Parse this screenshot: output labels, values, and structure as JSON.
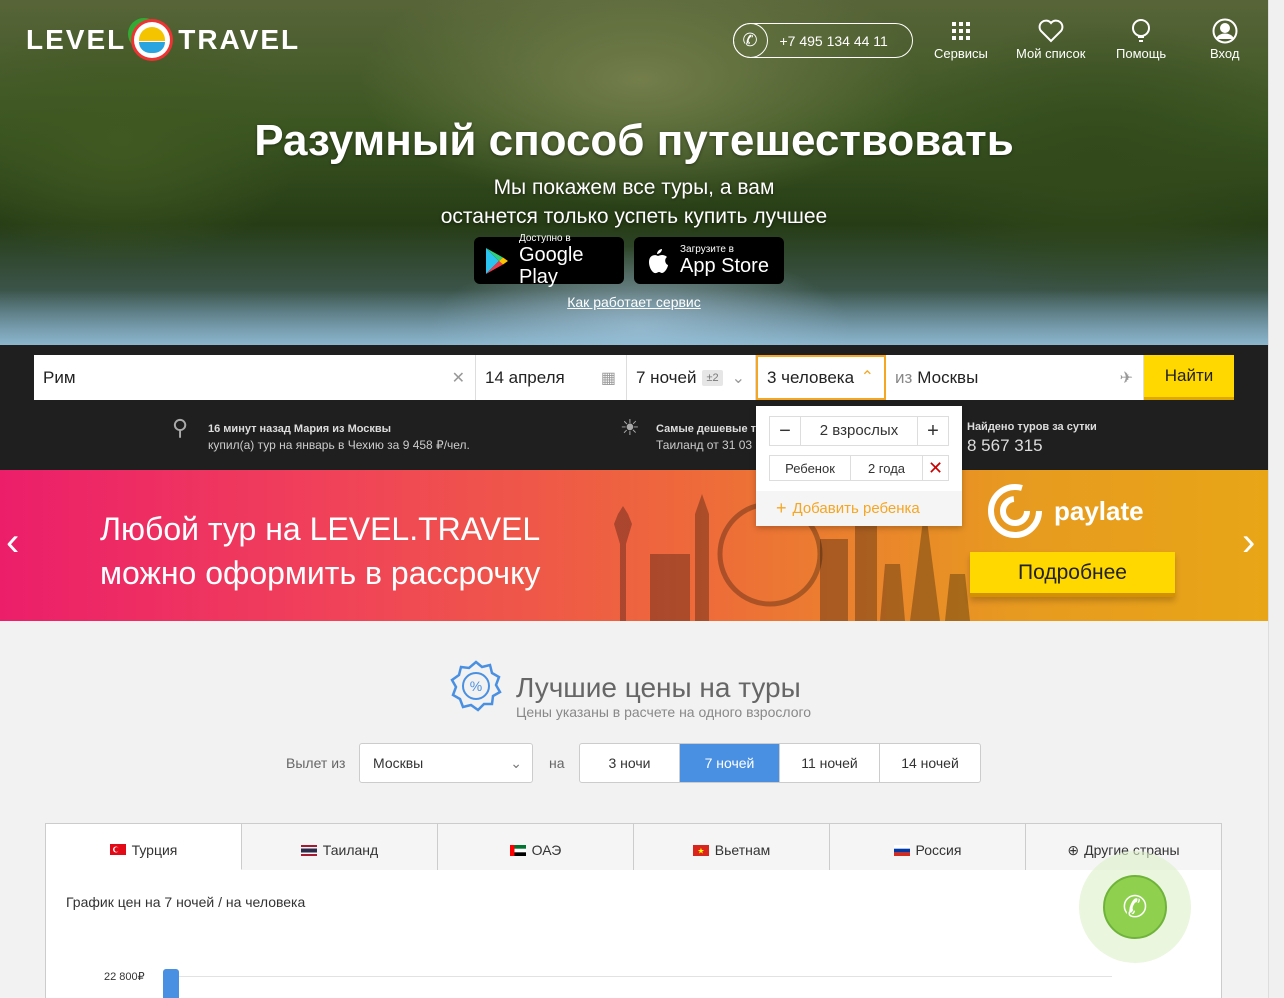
{
  "header": {
    "logo_left": "LEVEL",
    "logo_right": "TRAVEL",
    "phone": "+7 495 134 44 11",
    "nav": [
      {
        "label": "Сервисы",
        "icon": "grid-icon"
      },
      {
        "label": "Мой список",
        "icon": "heart-icon"
      },
      {
        "label": "Помощь",
        "icon": "bulb-icon"
      },
      {
        "label": "Вход",
        "icon": "user-icon"
      }
    ]
  },
  "hero": {
    "title": "Разумный способ путешествовать",
    "subtitle_line1": "Мы покажем все туры, а вам",
    "subtitle_line2": "останется только успеть купить лучшее",
    "google_small": "Доступно в",
    "google_big": "Google Play",
    "apple_small": "Загрузите в",
    "apple_big": "App Store",
    "how_link": "Как работает сервис"
  },
  "search": {
    "destination": "Рим",
    "date": "14 апреля",
    "nights": "7 ночей",
    "nights_badge": "±2",
    "persons": "3 человека",
    "from_prefix": "из",
    "from_city": "Москвы",
    "find_button": "Найти",
    "persons_dropdown": {
      "adults": "2 взрослых",
      "child_label": "Ребенок",
      "child_age": "2 года",
      "add_child": "Добавить ребенка"
    },
    "info": {
      "recent_line1": "16 минут назад Мария из Москвы",
      "recent_line2": "купил(а) тур на январь в Чехию за 9 458 ₽/чел.",
      "cheap_line1": "Самые дешевые т",
      "cheap_line2": "Таиланд от 31 03",
      "found_label": "Найдено туров за сутки",
      "found_value": "8 567 315"
    }
  },
  "banner": {
    "line1": "Любой тур на LEVEL.TRAVEL",
    "line2": "можно оформить в рассрочку",
    "brand": "paylate",
    "more_button": "Подробнее"
  },
  "best_prices": {
    "title": "Лучшие цены на туры",
    "subtitle": "Цены указаны в расчете на одного взрослого",
    "departure_label": "Вылет из",
    "departure_city": "Москвы",
    "on_label": "на",
    "nights_options": [
      "3 ночи",
      "7 ночей",
      "11 ночей",
      "14 ночей"
    ],
    "selected_nights_index": 1,
    "countries": [
      "Турция",
      "Таиланд",
      "ОАЭ",
      "Вьетнам",
      "Россия",
      "Другие страны"
    ],
    "selected_country_index": 0,
    "chart_title": "График цен на 7 ночей / на человека",
    "chart_tick": "22 800₽",
    "colors": {
      "accent_blue": "#4a90e2",
      "button_yellow": "#ffd800",
      "call_green": "#8fd14f"
    }
  }
}
